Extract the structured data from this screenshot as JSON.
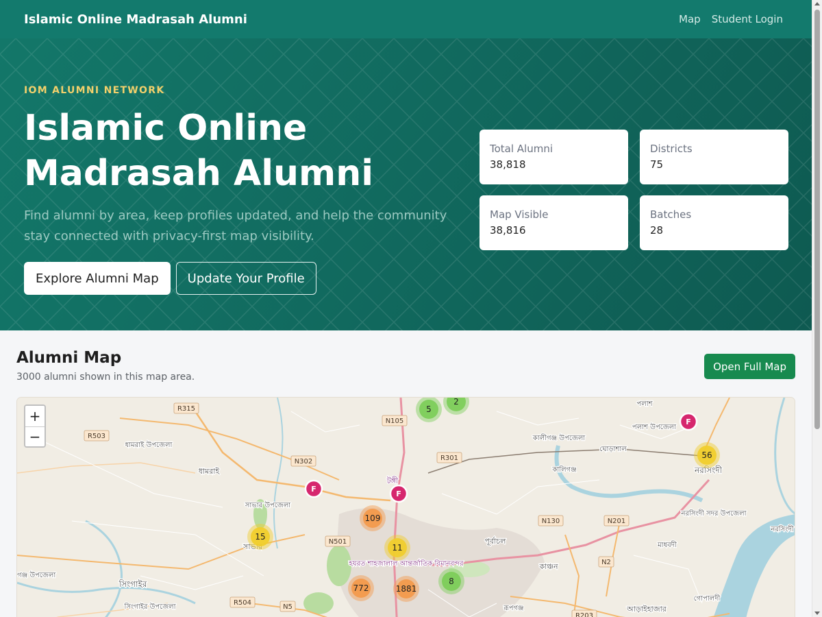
{
  "navbar": {
    "brand": "Islamic Online Madrasah Alumni",
    "links": [
      "Map",
      "Student Login"
    ]
  },
  "hero": {
    "eyebrow": "IOM ALUMNI NETWORK",
    "title_line1": "Islamic Online",
    "title_line2": "Madrasah Alumni",
    "subtitle": "Find alumni by area, keep profiles updated, and help the community stay connected with privacy-first map visibility.",
    "primary_button": "Explore Alumni Map",
    "secondary_button": "Update Your Profile"
  },
  "stats": [
    {
      "label": "Total Alumni",
      "value": "38,818"
    },
    {
      "label": "Districts",
      "value": "75"
    },
    {
      "label": "Map Visible",
      "value": "38,816"
    },
    {
      "label": "Batches",
      "value": "28"
    }
  ],
  "map_section": {
    "title": "Alumni Map",
    "count_text": "3000 alumni shown in this map area.",
    "open_button": "Open Full Map",
    "zoom_in": "+",
    "zoom_out": "−"
  },
  "map": {
    "road_labels": [
      "R315",
      "R503",
      "N105",
      "N302",
      "R301",
      "N501",
      "N130",
      "N201",
      "N2",
      "R504",
      "N5",
      "R203"
    ],
    "place_labels": [
      "পলাশ",
      "পলাশ উপজেলা",
      "কালীগঞ্জ উপজেলা",
      "ঘোড়াশাল",
      "কালিগঞ্জ",
      "নরসিংদী",
      "ধামরাই উপজেলা",
      "ধামরাই",
      "টঙ্গী",
      "সাভার উপজেলা",
      "সাভার",
      "পূর্বাচল",
      "কাঞ্চন",
      "মাধবদী",
      "নরসিংদী সদর উপজেলা",
      "নরসিংদী",
      "সিংগাইর",
      "সিংগাইর উপজেলা",
      "কেরানীগঞ্জ উপজেলা",
      "হযরত শাহজালাল আন্তর্জাতিক বিমানবন্দর",
      "রূপগঞ্জ",
      "আড়াইহাজার",
      "গোপালদী"
    ],
    "clusters": [
      {
        "label": "5",
        "tier": "small"
      },
      {
        "label": "2",
        "tier": "small"
      },
      {
        "label": "56",
        "tier": "medium"
      },
      {
        "label": "109",
        "tier": "large"
      },
      {
        "label": "15",
        "tier": "medium"
      },
      {
        "label": "11",
        "tier": "medium"
      },
      {
        "label": "8",
        "tier": "small"
      },
      {
        "label": "772",
        "tier": "large"
      },
      {
        "label": "1881",
        "tier": "large"
      }
    ],
    "pins": [
      "F",
      "F",
      "F"
    ],
    "colors": {
      "small": "#7dce5a",
      "medium": "#f0cd2d",
      "large": "#f39a4c",
      "pin": "#d6276e"
    }
  }
}
